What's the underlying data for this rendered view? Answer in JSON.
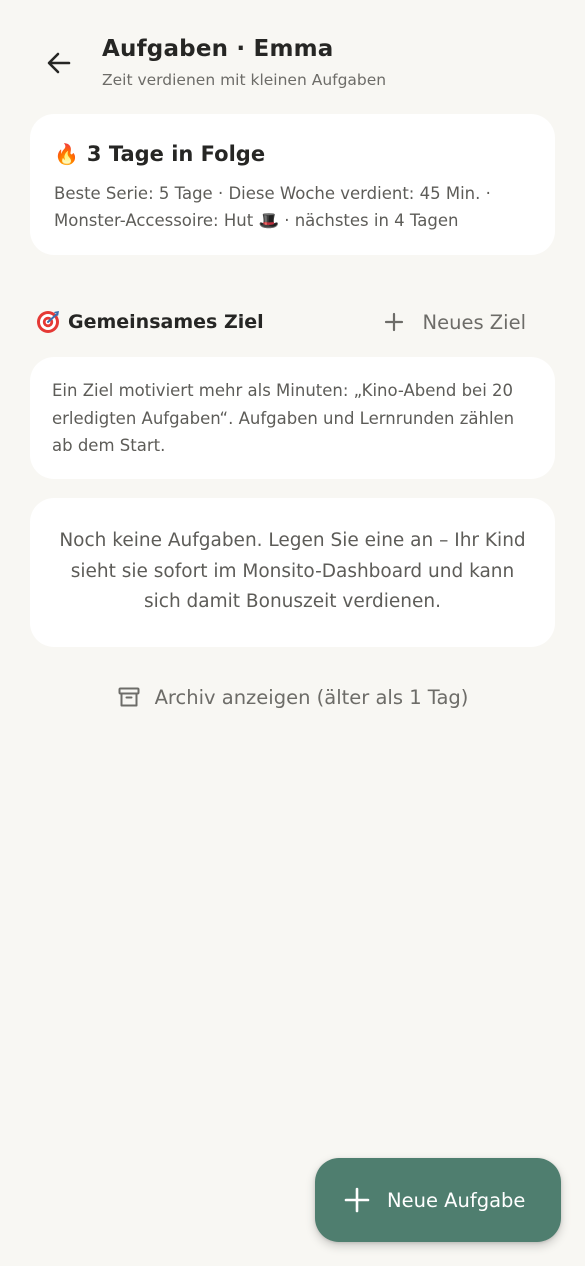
{
  "header": {
    "title": "Aufgaben · Emma",
    "subtitle": "Zeit verdienen mit kleinen Aufgaben"
  },
  "streak": {
    "emoji": "🔥",
    "title": "3 Tage in Folge",
    "details": "Beste Serie: 5 Tage · Diese Woche verdient: 45 Min. · Monster-Accessoire: Hut 🎩 · nächstes in 4 Tagen"
  },
  "goal_section": {
    "emoji": "🎯",
    "title": "Gemeinsames Ziel",
    "new_goal_label": "Neues Ziel",
    "description": "Ein Ziel motiviert mehr als Minuten: „Kino-Abend bei 20 erledigten Aufgaben“. Aufgaben und Lernrunden zählen ab dem Start."
  },
  "tasks": {
    "empty_message": "Noch keine Aufgaben. Legen Sie eine an – Ihr Kind sieht sie sofort im Monsito-Dashboard und kann sich damit Bonuszeit verdienen."
  },
  "archive": {
    "label": "Archiv anzeigen (älter als 1 Tag)"
  },
  "fab": {
    "label": "Neue Aufgabe"
  },
  "colors": {
    "background": "#f8f7f3",
    "card": "#ffffff",
    "accent": "#4f7e6f",
    "text_primary": "#262624",
    "text_secondary": "#5d5c58"
  },
  "icons": {
    "back": "arrow-left-icon",
    "flame": "flame-icon",
    "target": "target-icon",
    "plus": "plus-icon",
    "archive": "archive-box-icon"
  }
}
